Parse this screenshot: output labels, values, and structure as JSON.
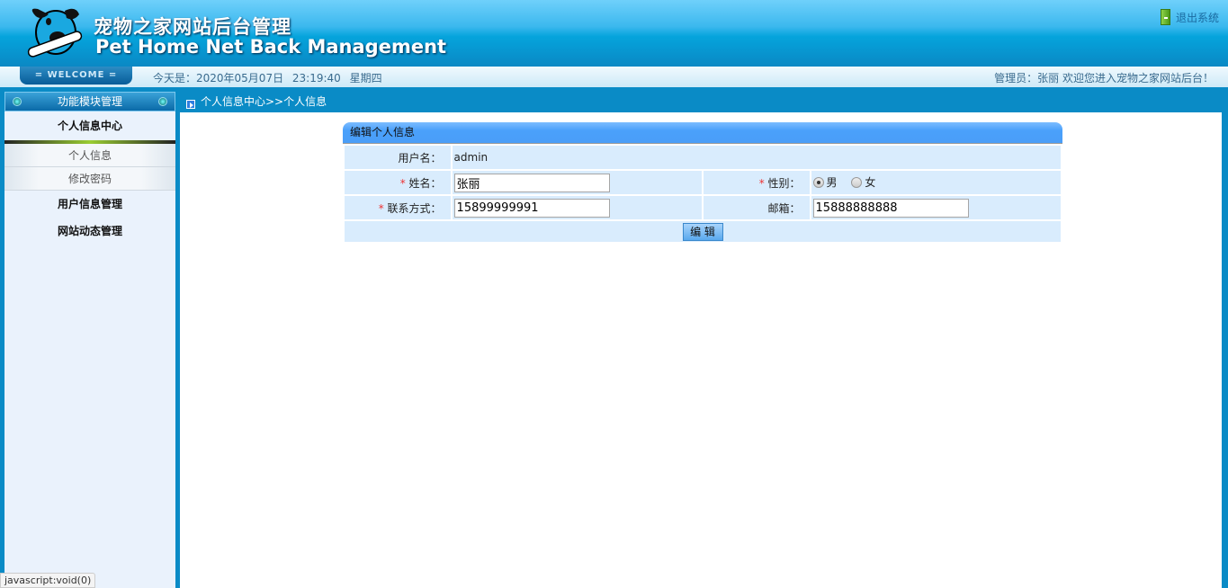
{
  "header": {
    "title_cn": "宠物之家网站后台管理",
    "title_en": "Pet Home Net Back Management",
    "logout": "退出系统"
  },
  "welcome_bar": {
    "welcome": "= WELCOME =",
    "date": "今天是：2020年05月07日 23:19:40 星期四",
    "admin": "管理员：张丽 欢迎您进入宠物之家网站后台！"
  },
  "sidebar": {
    "title": "功能模块管理",
    "groups": [
      {
        "label": "个人信息中心",
        "items": [
          "个人信息",
          "修改密码"
        ]
      },
      {
        "label": "用户信息管理"
      },
      {
        "label": "网站动态管理"
      }
    ]
  },
  "breadcrumb": "个人信息中心>>个人信息",
  "form": {
    "title": "编辑个人信息",
    "username_label": "用户名：",
    "username": "admin",
    "name_label": "姓名：",
    "name": "张丽",
    "gender_label": "性别：",
    "gender_options": [
      "男",
      "女"
    ],
    "gender_selected": "男",
    "phone_label": "联系方式：",
    "phone": "15899999991",
    "email_label": "邮箱：",
    "email": "15888888888",
    "required_mark": "*",
    "submit": "编 辑"
  },
  "status_bar": "javascript:void(0)"
}
